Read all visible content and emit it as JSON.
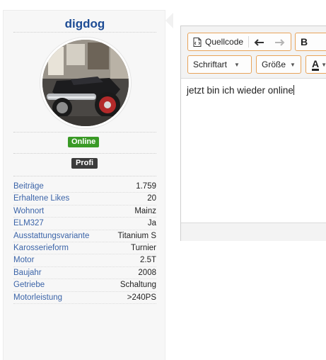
{
  "user": {
    "username": "digdog",
    "status": "Online",
    "rank": "Profi"
  },
  "stats": [
    {
      "label": "Beiträge",
      "value": "1.759"
    },
    {
      "label": "Erhaltene Likes",
      "value": "20"
    },
    {
      "label": "Wohnort",
      "value": "Mainz"
    },
    {
      "label": "ELM327",
      "value": "Ja"
    },
    {
      "label": "Ausstattungsvariante",
      "value": "Titanium S"
    },
    {
      "label": "Karosserieform",
      "value": "Turnier"
    },
    {
      "label": "Motor",
      "value": "2.5T"
    },
    {
      "label": "Baujahr",
      "value": "2008"
    },
    {
      "label": "Getriebe",
      "value": "Schaltung"
    },
    {
      "label": "Motorleistung",
      "value": ">240PS"
    }
  ],
  "editor": {
    "source_label": "Quellcode",
    "bold_label": "B",
    "font_label": "Schriftart",
    "size_label": "Größe",
    "color_label": "A",
    "content": "jetzt bin ich wieder online"
  },
  "colors": {
    "accent_border": "#e8a45a",
    "username": "#1d4c95",
    "online": "#3a9a26",
    "link": "#3b64a8"
  },
  "icons": {
    "source": "source-code-icon",
    "undo": "undo-icon",
    "redo": "redo-icon",
    "dropdown": "chevron-down-icon"
  }
}
